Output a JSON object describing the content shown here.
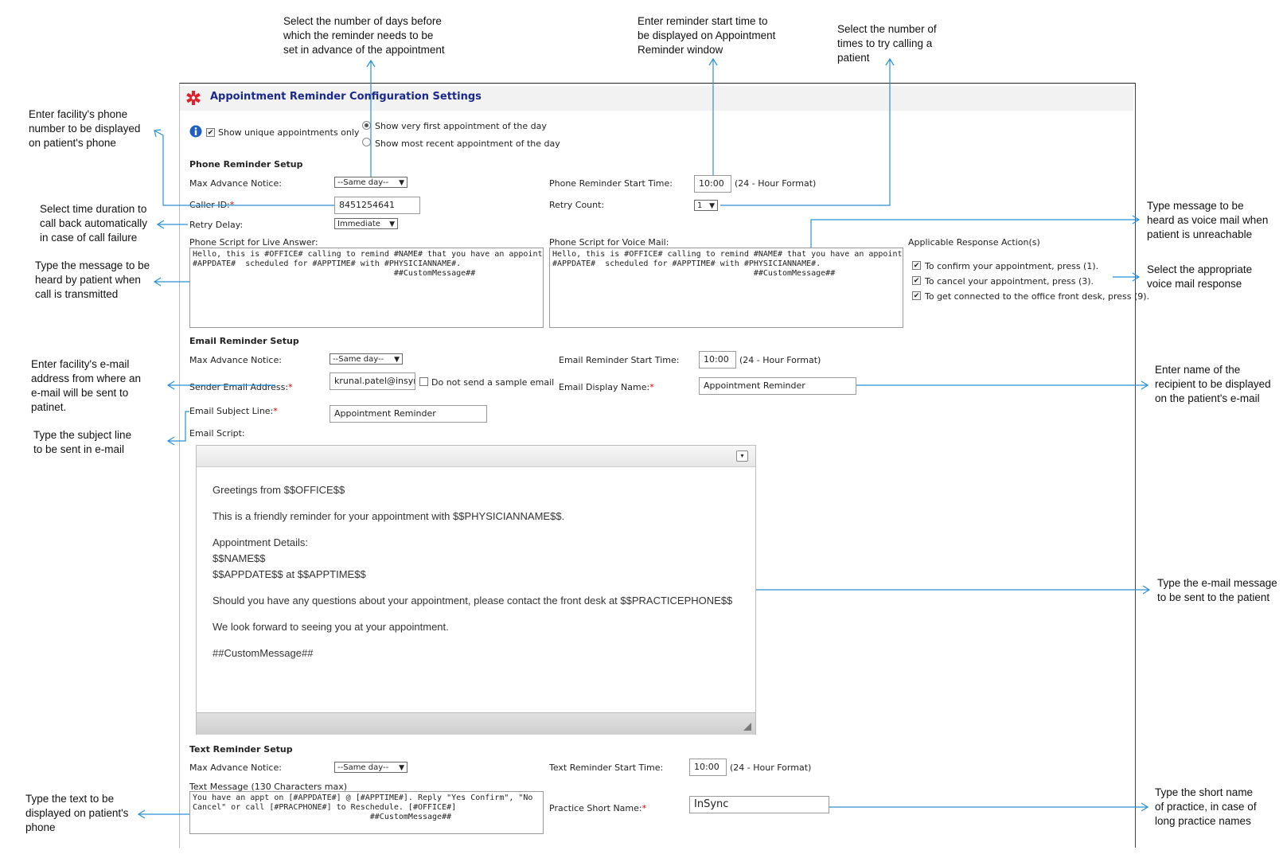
{
  "header": {
    "title": "Appointment Reminder Configuration Settings",
    "logo_icon": "red-caduceus-star-icon"
  },
  "top_options": {
    "show_unique": "Show unique appointments only",
    "radio_first": "Show very first appointment of the day",
    "radio_recent": "Show most recent appointment of the day"
  },
  "phone": {
    "section": "Phone Reminder Setup",
    "max_advance_label": "Max Advance Notice:",
    "max_advance_value": "--Same day--",
    "caller_id_label": "Caller ID:",
    "caller_id_value": "8451254641",
    "retry_delay_label": "Retry Delay:",
    "retry_delay_value": "Immediate",
    "start_time_label": "Phone Reminder Start Time:",
    "start_time_value": "10:00",
    "format_note": "(24 - Hour Format)",
    "retry_count_label": "Retry Count:",
    "retry_count_value": "1",
    "live_label": "Phone Script for Live Answer:",
    "live_script": "Hello, this is #OFFICE# calling to remind #NAME# that you have an appointment on\n#APPDATE#  scheduled for #APPTIME# with #PHYSICIANNAME#.\n                                          ##CustomMessage##",
    "voicemail_label": "Phone Script for Voice Mail:",
    "voicemail_script": "Hello, this is #OFFICE# calling to remind #NAME# that you have an appointment on\n#APPDATE#  scheduled for #APPTIME# with #PHYSICIANNAME#.\n                                          ##CustomMessage##",
    "response_label": "Applicable Response Action(s)",
    "responses": [
      "To confirm your appointment, press (1).",
      "To cancel your appointment, press (3).",
      "To get connected to the office front desk, press (9)."
    ]
  },
  "email": {
    "section": "Email Reminder Setup",
    "max_advance_label": "Max Advance Notice:",
    "max_advance_value": "--Same day--",
    "sender_label": "Sender Email Address:",
    "sender_value": "krunal.patel@insync",
    "no_sample_label": "Do not send a sample email",
    "subject_label": "Email Subject Line:",
    "subject_value": "Appointment Reminder",
    "script_label": "Email Script:",
    "start_time_label": "Email Reminder Start Time:",
    "start_time_value": "10:00",
    "format_note": "(24 - Hour Format)",
    "display_name_label": "Email Display Name:",
    "display_name_value": "Appointment Reminder",
    "body": {
      "greeting": "Greetings from $$OFFICE$$",
      "reminder": "This is a friendly reminder for your appointment with $$PHYSICIANNAME$$.",
      "details_head": "Appointment Details:",
      "details_name": "$$NAME$$",
      "details_date": "$$APPDATE$$ at $$APPTIME$$",
      "questions": "Should you have any questions about your appointment, please contact the front desk at $$PRACTICEPHONE$$",
      "closing": "We look forward to seeing you at your appointment.",
      "custom": "##CustomMessage##"
    }
  },
  "text": {
    "section": "Text Reminder Setup",
    "max_advance_label": "Max Advance Notice:",
    "max_advance_value": "--Same day--",
    "message_label": "Text Message (130 Characters max)",
    "message_value": "You have an appt on [#APPDATE#] @ [#APPTIME#]. Reply \"Yes Confirm\", \"No\nCancel\" or call [#PRACPHONE#] to Reschedule. [#OFFICE#]\n                                     ##CustomMessage##",
    "start_time_label": "Text Reminder Start Time:",
    "start_time_value": "10:00",
    "format_note": "(24 - Hour Format)",
    "short_name_label": "Practice Short Name:",
    "short_name_value": "InSync"
  },
  "annotations": {
    "days_before": [
      "Select the number of days before",
      "which the reminder needs to be",
      "set in advance of the appointment"
    ],
    "start_time": [
      "Enter reminder start time to",
      "be displayed on Appointment",
      "Reminder window"
    ],
    "retry_times": [
      "Select the number of",
      "times to try calling a",
      "patient"
    ],
    "facility_phone": [
      "Enter facility's phone",
      "number to be displayed",
      "on patient's phone"
    ],
    "retry_delay": [
      "Select time duration to",
      "call back automatically",
      "in case of call failure"
    ],
    "live_msg": [
      "Type the message to be",
      "heard by patient when",
      "call is transmitted"
    ],
    "voicemail_msg": [
      "Type message to be",
      "heard as voice mail when",
      "patient is unreachable"
    ],
    "vm_response": [
      "Select the appropriate",
      "voice mail response"
    ],
    "facility_email": [
      "Enter facility's e-mail",
      "address from where an",
      "e-mail will be sent to",
      "patinet."
    ],
    "subject": [
      "Type the subject line",
      "to be sent in e-mail"
    ],
    "recipient": [
      "Enter name of the",
      "recipient to be displayed",
      "on the patient's e-mail"
    ],
    "email_msg": [
      "Type the e-mail message",
      "to be sent to the patient"
    ],
    "text_msg": [
      "Type the text to be",
      "displayed on patient's",
      "phone"
    ],
    "short_name": [
      "Type the short name",
      "of practice, in case of",
      "long practice names"
    ]
  },
  "colors": {
    "accent_blue": "#1a2a8c",
    "callout_line": "#2a8fd4",
    "required": "#dd0000"
  }
}
